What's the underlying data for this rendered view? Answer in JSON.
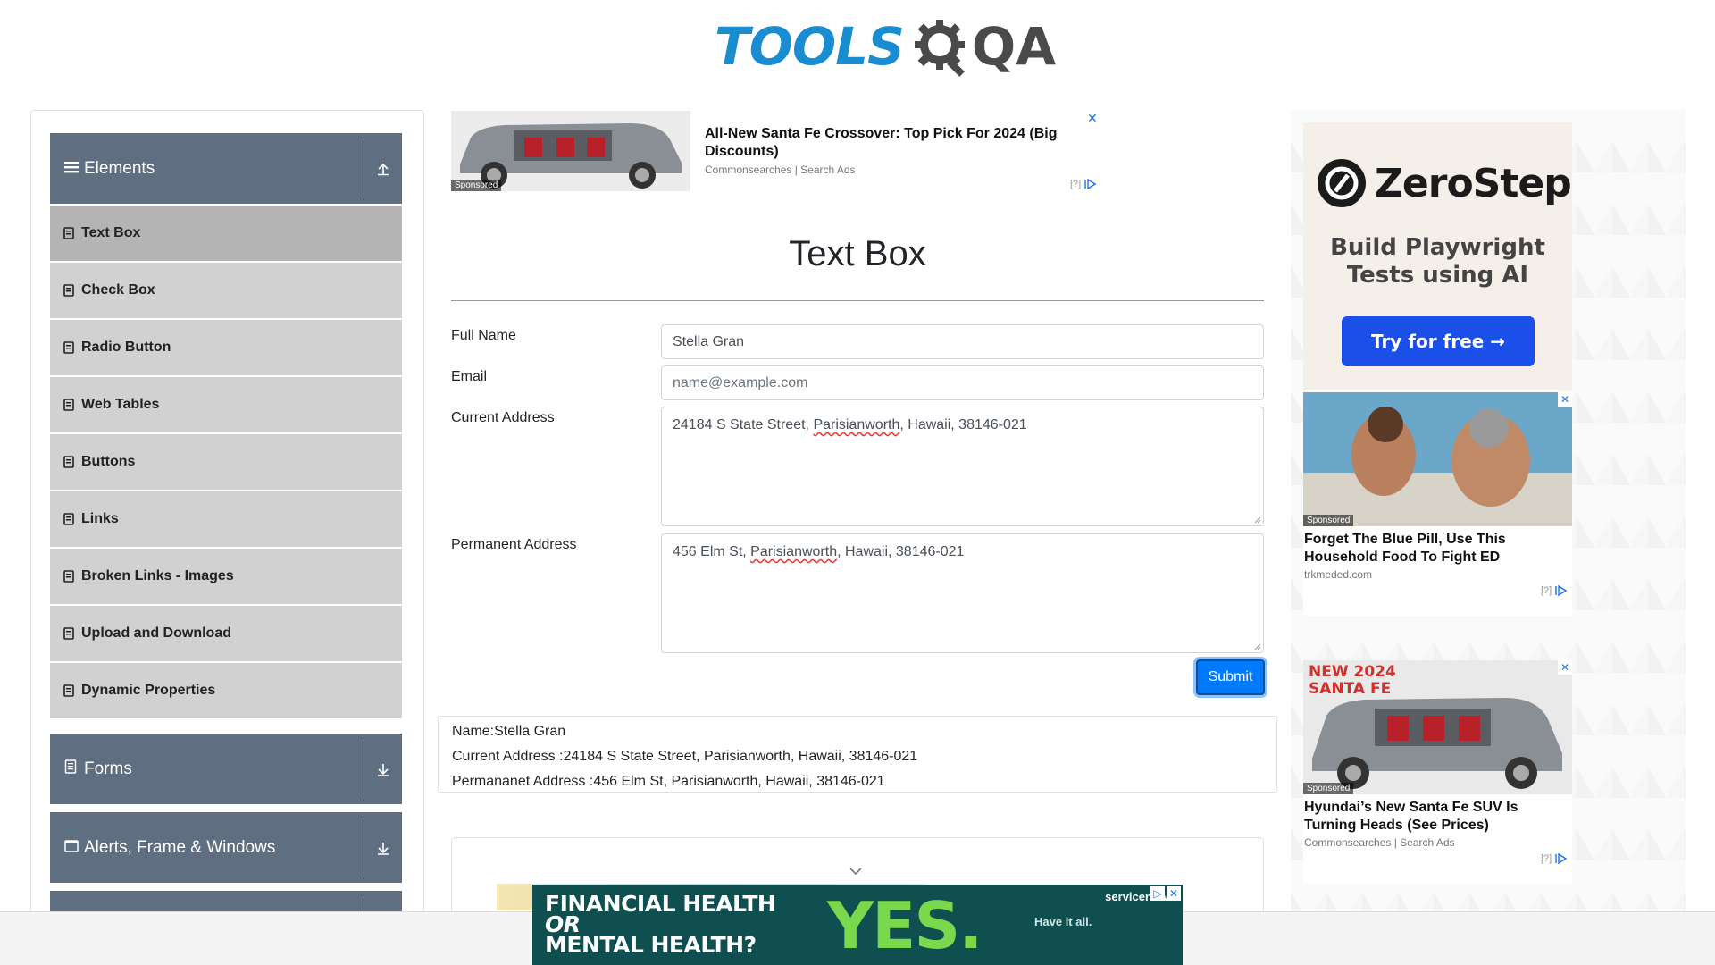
{
  "brand": {
    "logo_tools": "TOOLS",
    "logo_qa": "QA"
  },
  "sidebar": {
    "groups": [
      {
        "label": "Elements",
        "icon": "hamburger-icon",
        "state": "expanded"
      },
      {
        "label": "Forms",
        "icon": "form-icon",
        "state": "collapsed"
      },
      {
        "label": "Alerts, Frame & Windows",
        "icon": "window-icon",
        "state": "collapsed"
      }
    ],
    "items": [
      {
        "label": "Text Box",
        "active": true
      },
      {
        "label": "Check Box"
      },
      {
        "label": "Radio Button"
      },
      {
        "label": "Web Tables"
      },
      {
        "label": "Buttons"
      },
      {
        "label": "Links"
      },
      {
        "label": "Broken Links - Images"
      },
      {
        "label": "Upload and Download"
      },
      {
        "label": "Dynamic Properties"
      }
    ]
  },
  "top_ad": {
    "title": "All-New Santa Fe Crossover: Top Pick For 2024 (Big Discounts)",
    "source": "Commonsearches | Search Ads",
    "sponsored": "Sponsored",
    "adchoices": "[?]"
  },
  "form": {
    "title": "Text Box",
    "full_name_label": "Full Name",
    "full_name_value": "Stella Gran",
    "email_label": "Email",
    "email_placeholder": "name@example.com",
    "current_address_label": "Current Address",
    "current_address_prefix": "24184 S State Street, ",
    "current_address_flagged": "Parisianworth",
    "current_address_suffix": ", Hawaii, 38146-021",
    "permanent_address_label": "Permanent Address",
    "permanent_address_prefix": "456 Elm St, ",
    "permanent_address_flagged": "Parisianworth",
    "permanent_address_suffix": ", Hawaii, 38146-021",
    "submit_label": "Submit"
  },
  "output": {
    "name": "Name:Stella Gran",
    "current_address": "Current Address :24184 S State Street, Parisianworth, Hawaii, 38146-021",
    "permanent_address": "Permananet Address :456 Elm St, Parisianworth, Hawaii, 38146-021"
  },
  "right_ads": {
    "zerostep": {
      "name": "ZeroStep",
      "tagline": "Build Playwright Tests using AI",
      "cta": "Try for free →"
    },
    "ad1": {
      "sponsored": "Sponsored",
      "title": "Forget The Blue Pill, Use This Household Food To Fight ED",
      "source": "trkmeded.com",
      "adchoices": "[?]"
    },
    "ad2": {
      "badge": "NEW 2024 SANTA FE",
      "sponsored": "Sponsored",
      "title": "Hyundai’s New Santa Fe SUV Is Turning Heads (See Prices)",
      "source": "Commonsearches | Search Ads",
      "adchoices": "[?]"
    }
  },
  "bottom_banner": {
    "line1": "FINANCIAL HEALTH",
    "line2": "OR",
    "line3": "MENTAL HEALTH?",
    "yes": "YES.",
    "tagline": "Have it all.",
    "brand": "servicenow"
  },
  "colors": {
    "sidebar_header": "#5f6e80",
    "menu_item": "#d1d1d1",
    "menu_active": "#b4b4b4",
    "submit": "#007bff",
    "logo_blue": "#1a8dd1",
    "banner_green": "#79d84b"
  }
}
